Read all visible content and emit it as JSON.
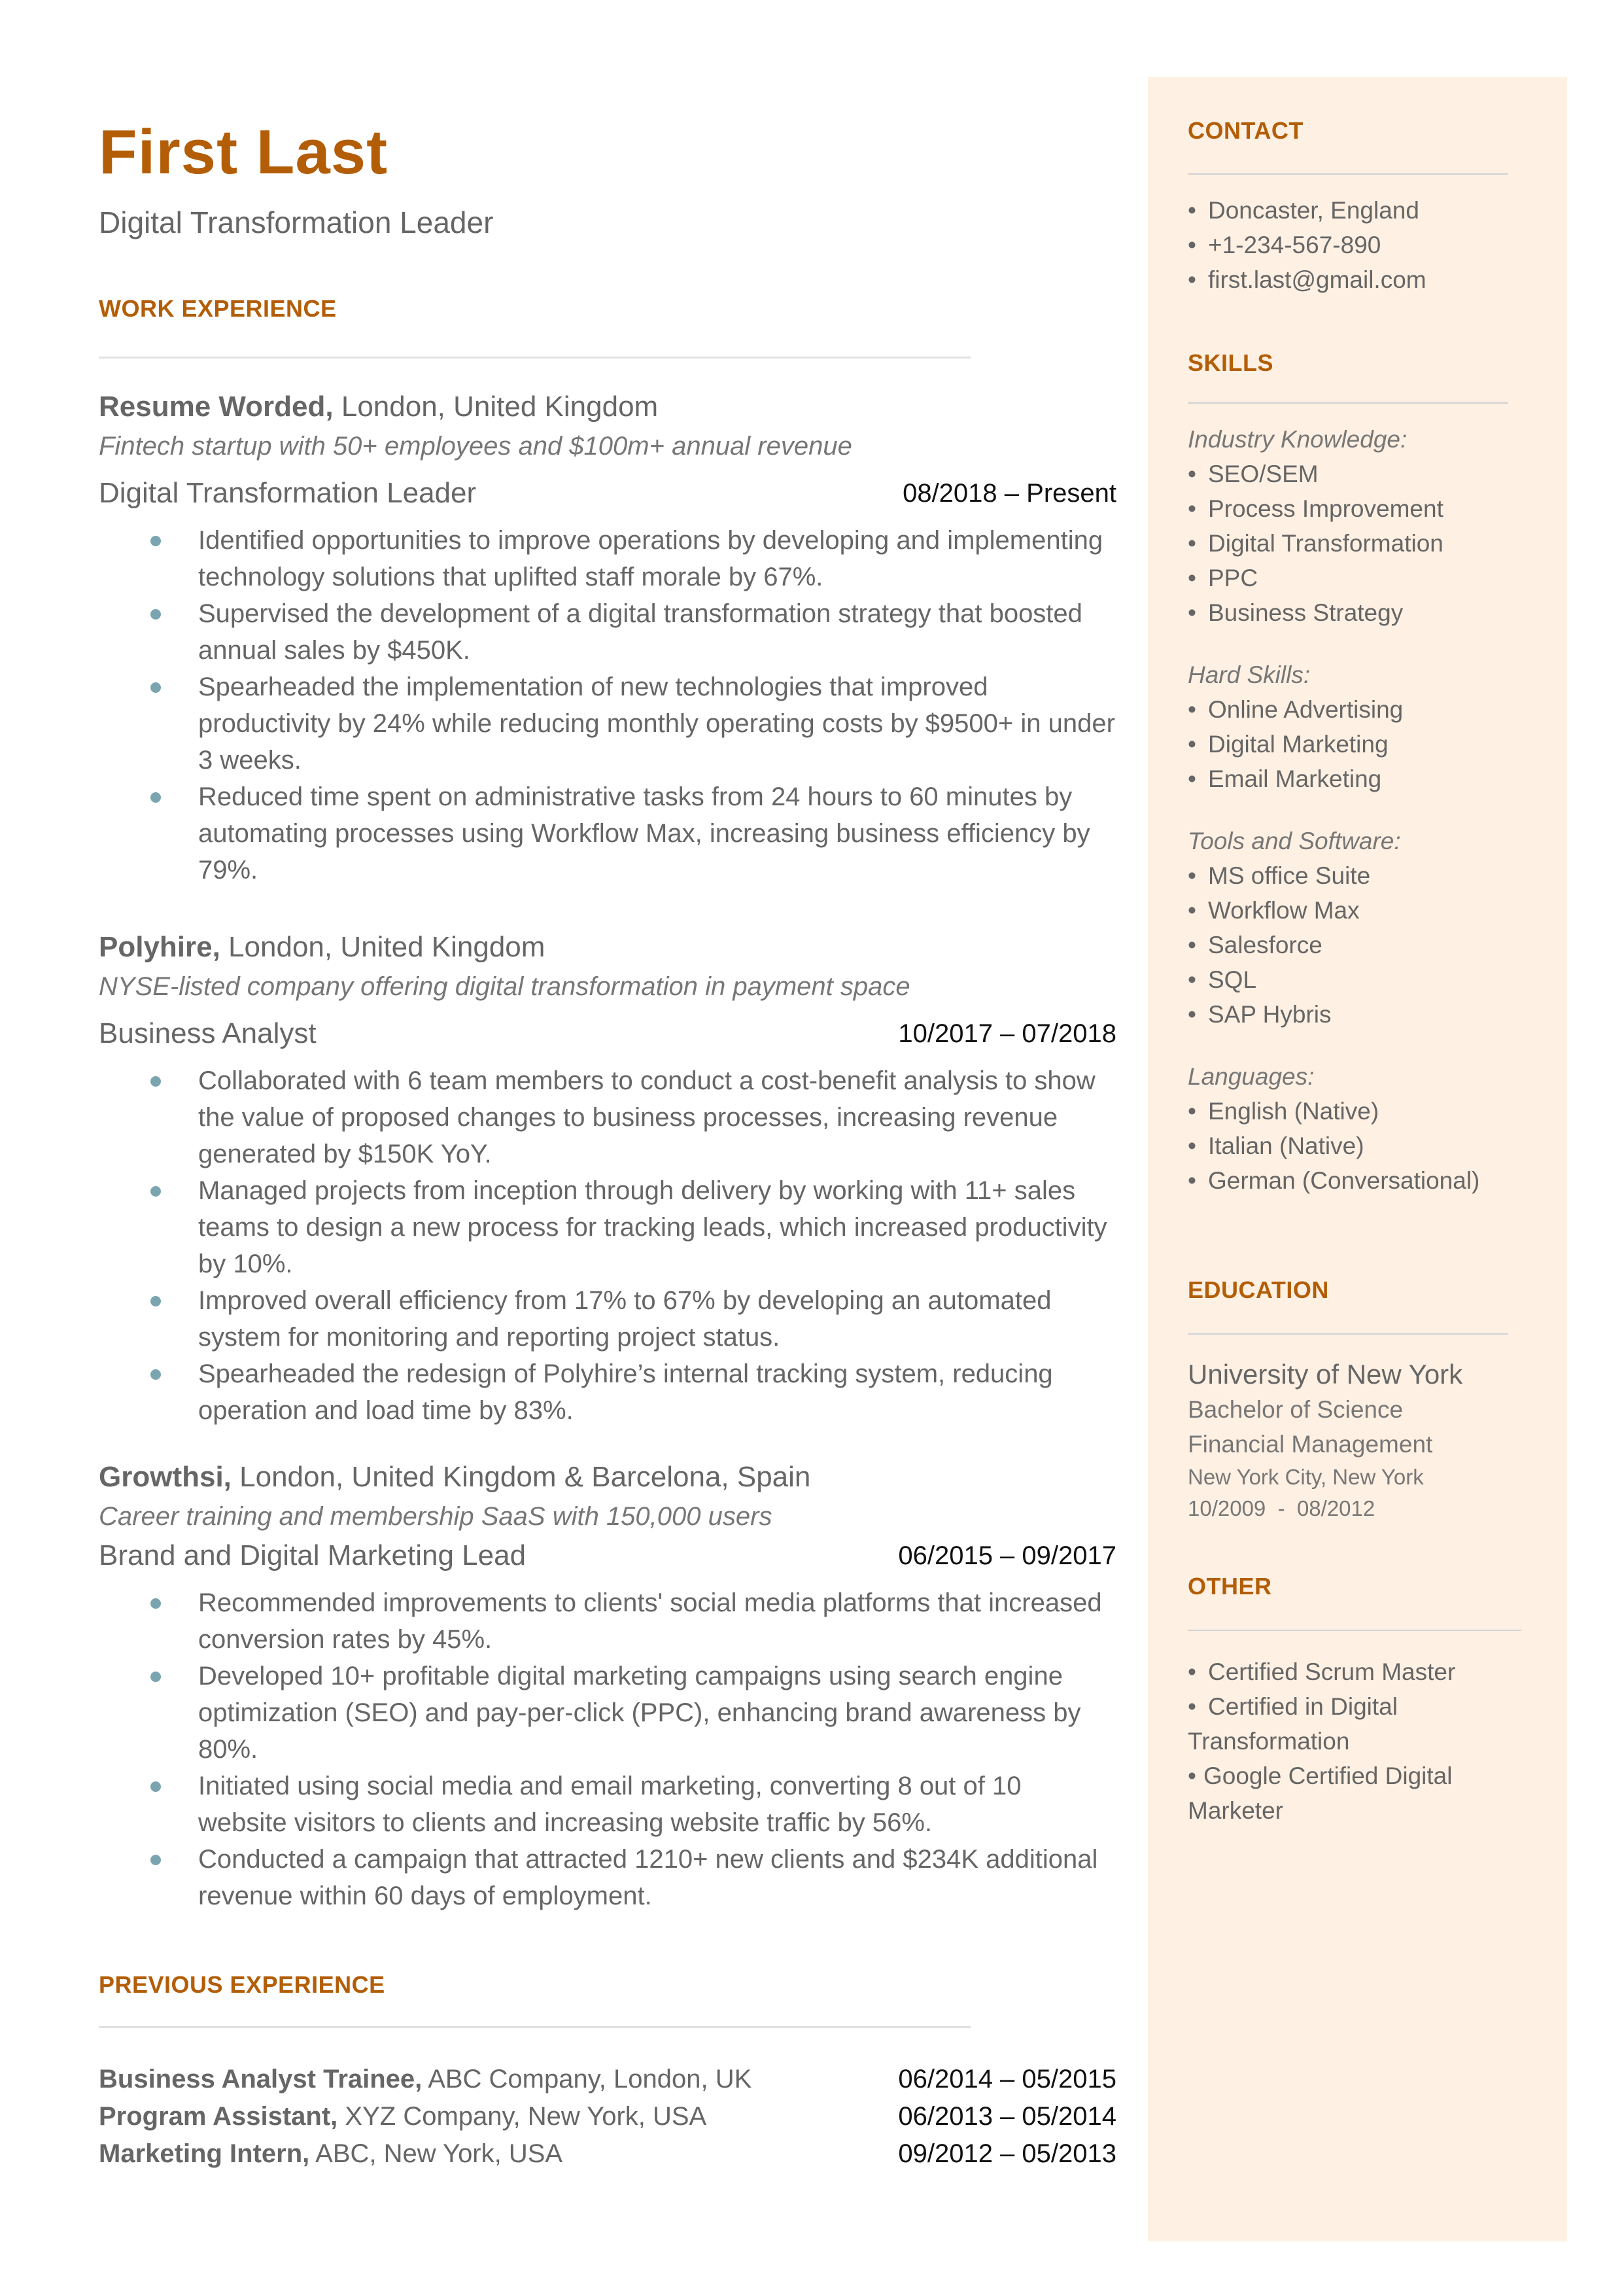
{
  "header": {
    "name": "First Last",
    "headline": "Digital Transformation Leader"
  },
  "colors": {
    "accent": "#B35E07",
    "sidebar_bg": "#FEF0E2",
    "bullet": "#7AA5B0",
    "text": "#666666"
  },
  "work": {
    "title": "WORK EXPERIENCE",
    "jobs": [
      {
        "company": "Resume Worded,",
        "location": "London, United Kingdom",
        "description": "Fintech startup with 50+ employees and $100m+ annual revenue",
        "role": "Digital Transformation Leader",
        "dates": "08/2018 – Present",
        "bullets": [
          "Identified opportunities to improve operations by developing and implementing technology solutions that uplifted staff morale by 67%.",
          "Supervised the development of a digital transformation strategy that boosted annual sales by $450K.",
          "Spearheaded the implementation of new technologies that improved productivity by 24% while reducing monthly operating costs by $9500+ in under 3 weeks.",
          "Reduced time spent on administrative tasks from 24 hours to 60 minutes by automating processes using Workflow Max, increasing business efficiency by 79%."
        ]
      },
      {
        "company": "Polyhire,",
        "location": "London, United Kingdom",
        "description": "NYSE-listed company offering digital transformation in payment space",
        "role": "Business Analyst",
        "dates": "10/2017 – 07/2018",
        "bullets": [
          "Collaborated with 6 team members to conduct a cost-benefit analysis to show the value of proposed changes to business processes, increasing revenue generated by $150K YoY.",
          "Managed projects from inception through delivery by working with 11+ sales teams to design a new process for tracking leads, which increased productivity by 10%.",
          "Improved overall efficiency from 17% to 67% by developing an automated system for monitoring and reporting project status.",
          "Spearheaded the redesign of Polyhire’s internal tracking system, reducing operation and load time by 83%."
        ]
      },
      {
        "company": "Growthsi,",
        "location": "London, United Kingdom & Barcelona, Spain",
        "description": "Career training and membership SaaS with 150,000 users",
        "role": "Brand and Digital Marketing Lead",
        "dates": "06/2015 – 09/2017",
        "bullets": [
          "Recommended improvements to clients' social media platforms that increased conversion rates by 45%.",
          "Developed 10+ profitable digital marketing campaigns using search engine optimization (SEO) and pay-per-click (PPC), enhancing brand awareness by 80%.",
          "Initiated using social media and email marketing, converting 8 out of 10 website visitors to clients and increasing website traffic by 56%.",
          "Conducted a campaign that attracted 1210+ new clients and $234K additional revenue within 60 days of employment."
        ]
      }
    ]
  },
  "previous": {
    "title": "PREVIOUS EXPERIENCE",
    "items": [
      {
        "role": "Business Analyst Trainee,",
        "org": "ABC Company, London, UK",
        "dates": "06/2014 – 05/2015"
      },
      {
        "role": "Program Assistant,",
        "org": "XYZ Company, New York, USA",
        "dates": "06/2013 – 05/2014"
      },
      {
        "role": "Marketing Intern,",
        "org": "ABC, New York, USA",
        "dates": "09/2012 – 05/2013"
      }
    ]
  },
  "sidebar": {
    "contact": {
      "title": "CONTACT",
      "items": [
        "Doncaster, England",
        "+1-234-567-890",
        "first.last@gmail.com"
      ]
    },
    "skills": {
      "title": "SKILLS",
      "groups": [
        {
          "label": "Industry Knowledge:",
          "items": [
            "SEO/SEM",
            "Process Improvement",
            "Digital Transformation",
            "PPC",
            "Business Strategy"
          ]
        },
        {
          "label": "Hard Skills:",
          "items": [
            "Online Advertising",
            "Digital Marketing",
            "Email Marketing"
          ]
        },
        {
          "label": "Tools and Software:",
          "items": [
            "MS office Suite",
            "Workflow Max",
            "Salesforce",
            "SQL",
            "SAP Hybris"
          ]
        },
        {
          "label": "Languages:",
          "items": [
            "English (Native)",
            "Italian (Native)",
            "German (Conversational)"
          ]
        }
      ]
    },
    "education": {
      "title": "EDUCATION",
      "school": "University of New York",
      "degree": "Bachelor of Science",
      "field": "Financial Management",
      "location": "New York City, New York",
      "dates": "10/2009  -  08/2012"
    },
    "other": {
      "title": "OTHER",
      "items": [
        "Certified Scrum Master",
        "Certified in Digital Transformation",
        "Google Certified Digital Marketer"
      ]
    },
    "bullet_glyph": "•"
  }
}
